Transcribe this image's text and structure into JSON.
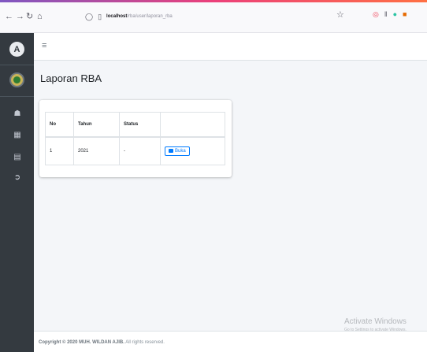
{
  "browser": {
    "url_host": "localhost",
    "url_path": "/rba/user/laporan_rba"
  },
  "sidebar": {
    "logo_letter": "A",
    "items": [
      {
        "icon": "home-icon"
      },
      {
        "icon": "grid-icon"
      },
      {
        "icon": "chart-icon"
      },
      {
        "icon": "logout-icon"
      }
    ]
  },
  "page": {
    "title": "Laporan RBA"
  },
  "table": {
    "headers": {
      "no": "No",
      "tahun": "Tahun",
      "status": "Status",
      "action": ""
    },
    "rows": [
      {
        "no": "1",
        "tahun": "2021",
        "status": "-",
        "action_label": "Buka"
      }
    ]
  },
  "footer": {
    "prefix": "Copyright © 2020 ",
    "author": "MUH. WILDAN AJIB.",
    "suffix": " All rights reserved."
  },
  "watermark": {
    "title": "Activate Windows",
    "subtitle": "Go to Settings to activate Windows."
  },
  "colors": {
    "accent": "#007bff",
    "sidebar": "#343a40"
  }
}
